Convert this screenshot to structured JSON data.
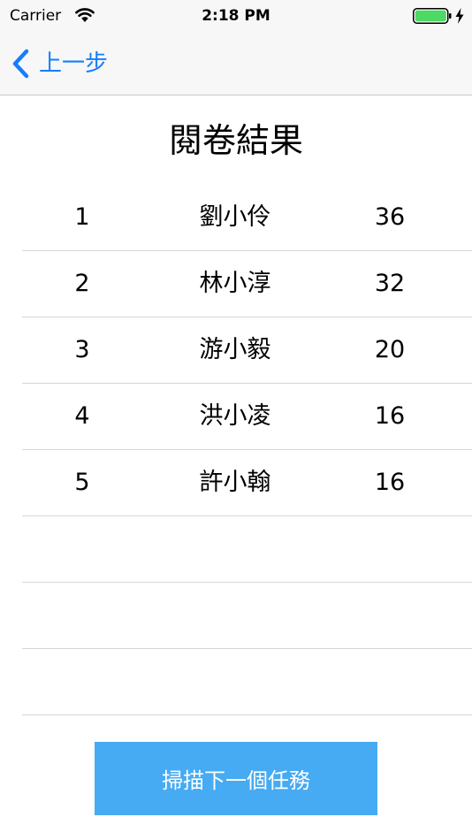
{
  "status_bar": {
    "carrier": "Carrier",
    "time": "2:18 PM",
    "battery_level": 1.0,
    "battery_color": "#4cd964",
    "icons": [
      "wifi-icon",
      "battery-icon",
      "charging-bolt-icon"
    ]
  },
  "nav": {
    "back_label": "上一步",
    "back_icon": "chevron-left-icon",
    "tint_color": "#157efb"
  },
  "page": {
    "title": "閱卷結果"
  },
  "results": {
    "rows": [
      {
        "rank": "1",
        "name": "劉小伶",
        "score": "36"
      },
      {
        "rank": "2",
        "name": "林小淳",
        "score": "32"
      },
      {
        "rank": "3",
        "name": "游小毅",
        "score": "20"
      },
      {
        "rank": "4",
        "name": "洪小凌",
        "score": "16"
      },
      {
        "rank": "5",
        "name": "許小翰",
        "score": "16"
      },
      {
        "rank": "",
        "name": "",
        "score": ""
      },
      {
        "rank": "",
        "name": "",
        "score": ""
      },
      {
        "rank": "",
        "name": "",
        "score": ""
      }
    ]
  },
  "actions": {
    "next_task_label": "掃描下一個任務",
    "button_color": "#46abf3"
  }
}
